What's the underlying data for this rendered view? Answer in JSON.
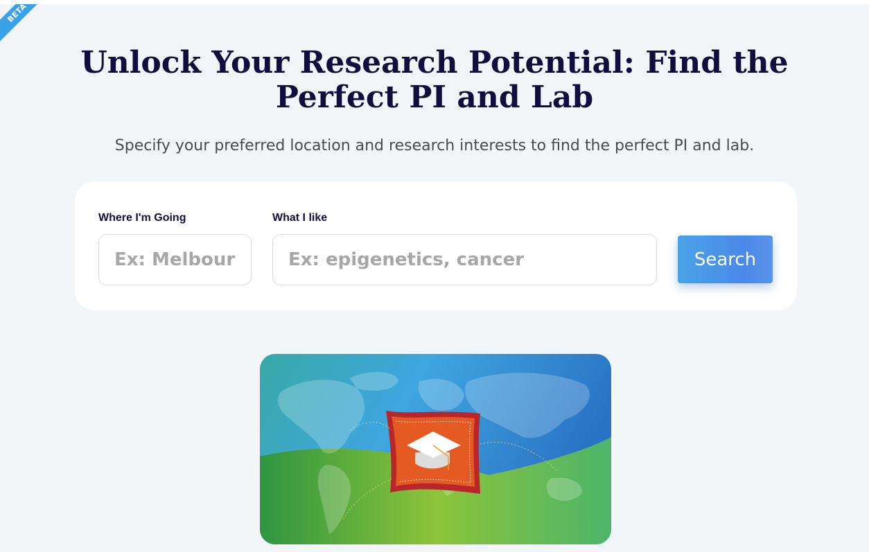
{
  "badge": {
    "label": "BETA",
    "color": "#3aa0e8"
  },
  "hero": {
    "title_line1": "Unlock Your Research Potential: Find the",
    "title_line2": "Perfect PI and Lab",
    "subtitle": "Specify your preferred location and research interests to find the perfect PI and lab."
  },
  "search": {
    "location_label": "Where I'm Going",
    "location_placeholder": "Ex: Melbourne",
    "location_value": "",
    "interest_label": "What I like",
    "interest_placeholder": "Ex: epigenetics, cancer",
    "interest_value": "",
    "button_label": "Search"
  },
  "illustration": {
    "icon": "graduation-cap-flag-icon",
    "description_colors": {
      "sky": "#3fa6e0",
      "ground": "#5cb74a",
      "flag": "#e55a22",
      "flag_border": "#b8262a"
    }
  },
  "colors": {
    "page_background": "#f2f6f9",
    "heading": "#100e3c",
    "accent": "#4b88ea"
  }
}
